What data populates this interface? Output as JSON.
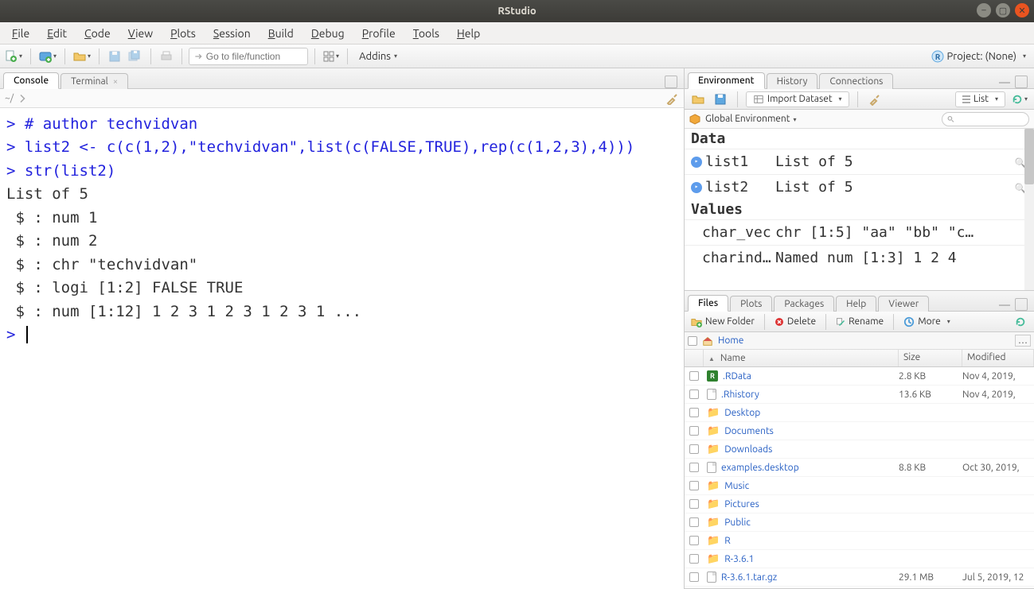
{
  "window": {
    "title": "RStudio"
  },
  "menubar": [
    "File",
    "Edit",
    "Code",
    "View",
    "Plots",
    "Session",
    "Build",
    "Debug",
    "Profile",
    "Tools",
    "Help"
  ],
  "toolbar": {
    "goto_placeholder": "Go to file/function",
    "addins_label": "Addins",
    "project_label": "Project: (None)"
  },
  "left": {
    "tabs": {
      "console": "Console",
      "terminal": "Terminal"
    },
    "path": "~/",
    "console_lines": [
      {
        "prompt": "> ",
        "text": "# author techvidvan",
        "cls": "prompt"
      },
      {
        "prompt": "> ",
        "text": "list2 <- c(c(1,2),\"techvidvan\",list(c(FALSE,TRUE),rep(c(1,2,3),4)))",
        "cls": "prompt"
      },
      {
        "prompt": "> ",
        "text": "str(list2)",
        "cls": "prompt"
      },
      {
        "prompt": "",
        "text": "List of 5",
        "cls": ""
      },
      {
        "prompt": "",
        "text": " $ : num 1",
        "cls": ""
      },
      {
        "prompt": "",
        "text": " $ : num 2",
        "cls": ""
      },
      {
        "prompt": "",
        "text": " $ : chr \"techvidvan\"",
        "cls": ""
      },
      {
        "prompt": "",
        "text": " $ : logi [1:2] FALSE TRUE",
        "cls": ""
      },
      {
        "prompt": "",
        "text": " $ : num [1:12] 1 2 3 1 2 3 1 2 3 1 ...",
        "cls": ""
      }
    ],
    "final_prompt": "> "
  },
  "env": {
    "tabs": [
      "Environment",
      "History",
      "Connections"
    ],
    "import_label": "Import Dataset",
    "list_label": "List",
    "scope_label": "Global Environment",
    "sections": {
      "data_hdr": "Data",
      "values_hdr": "Values"
    },
    "data_rows": [
      {
        "name": "list1",
        "value": "List of 5"
      },
      {
        "name": "list2",
        "value": "List of 5"
      }
    ],
    "value_rows": [
      {
        "name": "char_vec",
        "value": "chr [1:5] \"aa\" \"bb\" \"c…"
      },
      {
        "name": "charind…",
        "value": "Named num [1:3] 1 2 4"
      }
    ]
  },
  "files": {
    "tabs": [
      "Files",
      "Plots",
      "Packages",
      "Help",
      "Viewer"
    ],
    "btn_new_folder": "New Folder",
    "btn_delete": "Delete",
    "btn_rename": "Rename",
    "btn_more": "More",
    "breadcrumb_home": "Home",
    "cols": {
      "name": "Name",
      "size": "Size",
      "mod": "Modified"
    },
    "rows": [
      {
        "icon": "rdata",
        "name": ".RData",
        "size": "2.8 KB",
        "mod": "Nov 4, 2019,"
      },
      {
        "icon": "doc",
        "name": ".Rhistory",
        "size": "13.6 KB",
        "mod": "Nov 4, 2019,"
      },
      {
        "icon": "folder",
        "name": "Desktop",
        "size": "",
        "mod": ""
      },
      {
        "icon": "folder",
        "name": "Documents",
        "size": "",
        "mod": ""
      },
      {
        "icon": "folder",
        "name": "Downloads",
        "size": "",
        "mod": ""
      },
      {
        "icon": "doc",
        "name": "examples.desktop",
        "size": "8.8 KB",
        "mod": "Oct 30, 2019,"
      },
      {
        "icon": "folder",
        "name": "Music",
        "size": "",
        "mod": ""
      },
      {
        "icon": "folder",
        "name": "Pictures",
        "size": "",
        "mod": ""
      },
      {
        "icon": "folder",
        "name": "Public",
        "size": "",
        "mod": ""
      },
      {
        "icon": "folder",
        "name": "R",
        "size": "",
        "mod": ""
      },
      {
        "icon": "folder",
        "name": "R-3.6.1",
        "size": "",
        "mod": ""
      },
      {
        "icon": "doc",
        "name": "R-3.6.1.tar.gz",
        "size": "29.1 MB",
        "mod": "Jul 5, 2019, 12"
      }
    ]
  }
}
